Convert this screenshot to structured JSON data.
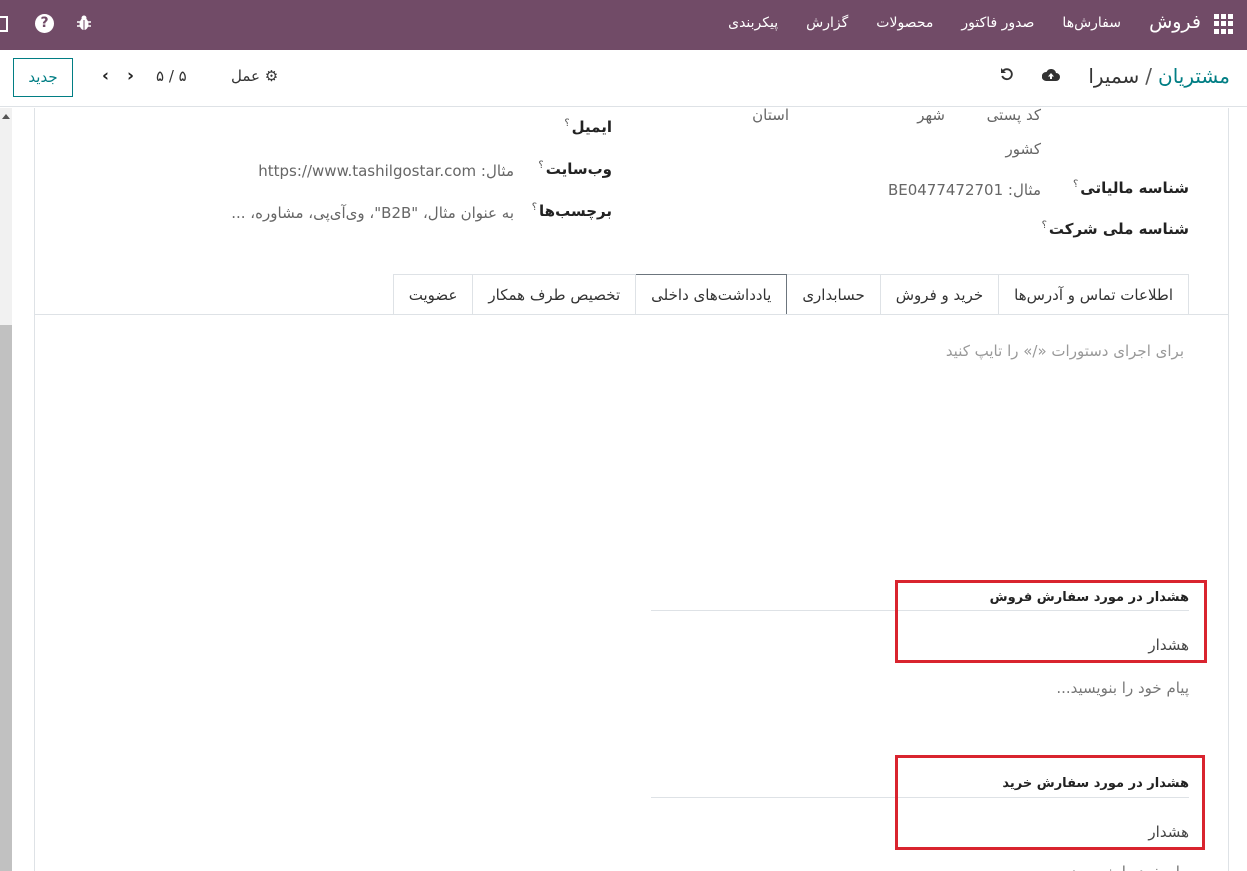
{
  "navbar": {
    "brand": "فروش",
    "menu": [
      "سفارش‌ها",
      "صدور فاکتور",
      "محصولات",
      "گزارش",
      "پیکربندی"
    ],
    "help_glyph": "?"
  },
  "control_panel": {
    "breadcrumb_parent": "مشتریان",
    "breadcrumb_separator": "/",
    "breadcrumb_current": "سمیرا",
    "action_label": "عمل",
    "pager": "۵ / ۵",
    "new_label": "جدید"
  },
  "form": {
    "email_label": "ایمیل",
    "website_label": "وب‌سایت",
    "website_placeholder": "مثال: https://www.tashilgostar.com",
    "tags_label": "برچسب‌ها",
    "tags_placeholder": "به عنوان مثال، \"B2B\"، وی‌آی‌پی، مشاوره، ...",
    "zip_placeholder": "کد پستی",
    "city_placeholder": "شهر",
    "state_placeholder": "استان",
    "country_placeholder": "کشور",
    "vat_label": "شناسه مالیاتی",
    "vat_placeholder": "مثال: BE0477472701",
    "company_id_label": "شناسه ملی شرکت",
    "help_mark": "؟"
  },
  "tabs": [
    {
      "label": "اطلاعات تماس و آدرس‌ها",
      "active": false
    },
    {
      "label": "خرید و فروش",
      "active": false
    },
    {
      "label": "حسابداری",
      "active": false
    },
    {
      "label": "یادداشت‌های داخلی",
      "active": true
    },
    {
      "label": "تخصیص طرف همکار",
      "active": false
    },
    {
      "label": "عضویت",
      "active": false
    }
  ],
  "notes": {
    "editor_placeholder": "برای اجرای دستورات «/» را تایپ کنید"
  },
  "sale_warning": {
    "title": "هشدار در مورد سفارش فروش",
    "value": "هشدار",
    "message_placeholder": "پیام خود را بنویسید..."
  },
  "purchase_warning": {
    "title": "هشدار در مورد سفارش خرید",
    "value": "هشدار",
    "message_placeholder": "پیام خود را بنویسید..."
  },
  "colors": {
    "navbar": "#714B67",
    "link": "#017e84",
    "highlight": "#d9242f"
  }
}
